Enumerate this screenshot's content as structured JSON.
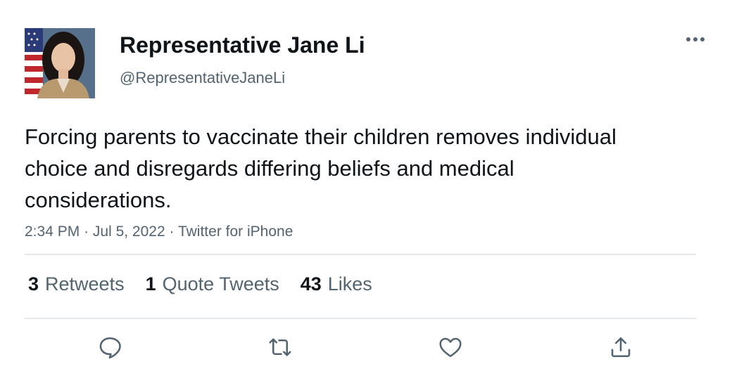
{
  "tweet": {
    "author_name": "Representative Jane Li",
    "author_handle": "@RepresentativeJaneLi",
    "text": "Forcing parents to vaccinate their children removes individual choice and disregards differing beliefs and medical considerations.",
    "time": "2:34 PM",
    "separator": "·",
    "date": "Jul 5, 2022",
    "source": "Twitter for iPhone"
  },
  "stats": [
    {
      "count": "3",
      "label": "Retweets"
    },
    {
      "count": "1",
      "label": "Quote Tweets"
    },
    {
      "count": "43",
      "label": "Likes"
    }
  ],
  "icons": {
    "more": "more-dots-icon",
    "reply": "reply-bubble-icon",
    "retweet": "retweet-arrows-icon",
    "like": "heart-icon",
    "share": "share-upload-icon"
  },
  "colors": {
    "text_primary": "#0f1419",
    "text_secondary": "#536471",
    "divider": "#e5e8eb",
    "icon": "#536471"
  }
}
